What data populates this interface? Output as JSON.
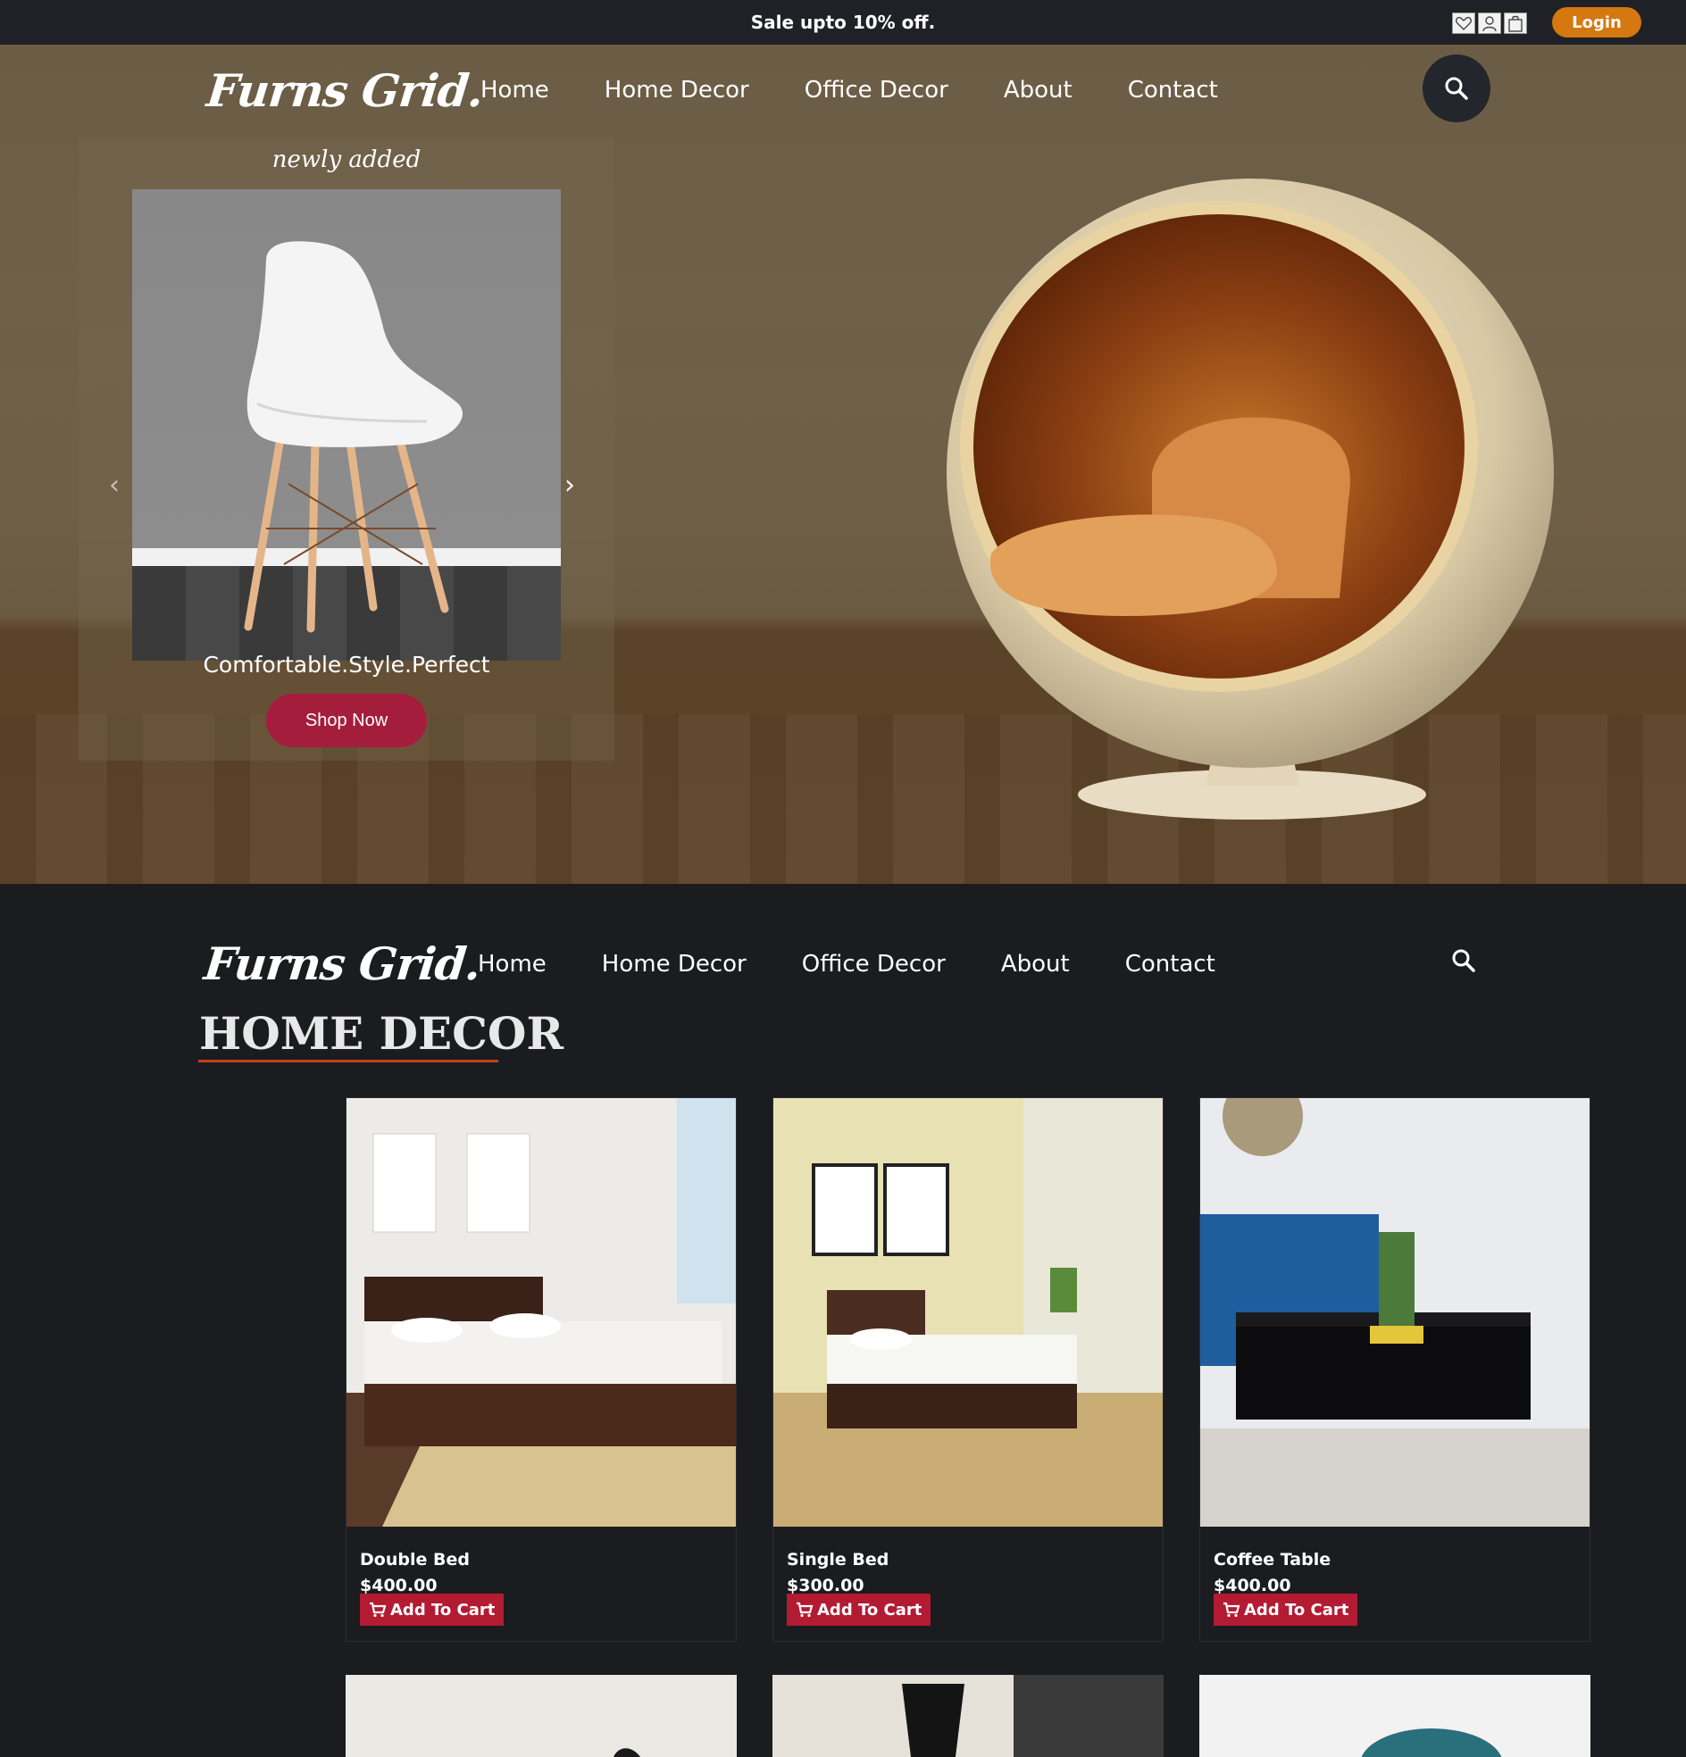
{
  "promo": {
    "text": "Sale upto 10% off."
  },
  "header": {
    "brand": "Furns Grid.",
    "login_label": "Login",
    "nav": [
      "Home",
      "Home Decor",
      "Office Decor",
      "About",
      "Contact"
    ]
  },
  "hero": {
    "carousel_title": "newly added",
    "caption": "Comfortable.Style.Perfect",
    "cta_label": "Shop Now",
    "prev_arrow": "‹",
    "next_arrow": "›"
  },
  "section": {
    "title": "HOME DECOR",
    "products": [
      {
        "name": "Double Bed",
        "price": "$400.00",
        "button": "Add To Cart"
      },
      {
        "name": "Single Bed",
        "price": "$300.00",
        "button": "Add To Cart"
      },
      {
        "name": "Coffee Table",
        "price": "$400.00",
        "button": "Add To Cart"
      }
    ]
  },
  "colors": {
    "accent": "#d4780f",
    "cta": "#a51d3d",
    "cart": "#b31b33",
    "underline": "#c0421a"
  },
  "icons": [
    "heart-icon",
    "user-icon",
    "bag-icon",
    "search-icon",
    "cart-icon"
  ]
}
